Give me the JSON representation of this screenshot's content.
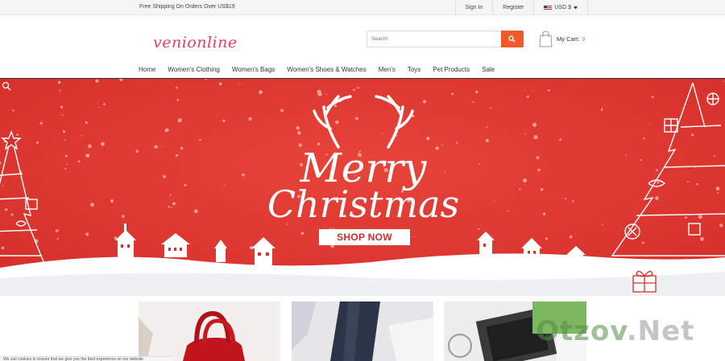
{
  "topbar": {
    "shipping": "Free Shipping On Orders Over US$19",
    "sign_in": "Sign In",
    "register": "Register",
    "currency": "USD $"
  },
  "header": {
    "logo": "venionline",
    "search_placeholder": "Search",
    "cart_label": "My Cart:",
    "cart_count": "0"
  },
  "nav": [
    "Home",
    "Women's Clothing",
    "Women's Bags",
    "Women's Shoes & Watches",
    "Men's",
    "Toys",
    "Pet Products",
    "Sale"
  ],
  "banner": {
    "line1": "Merry",
    "line2": "Christmas",
    "cta": "SHOP NOW",
    "bg_color": "#e03a33"
  },
  "cookie_notice": "We use cookies to ensure that we give you the best experience on our website",
  "watermark": {
    "part1": "Otzov",
    "part2": ".Net"
  },
  "colors": {
    "accent": "#ef5a2a",
    "logo": "#e23d63",
    "banner_red": "#e03a33"
  }
}
